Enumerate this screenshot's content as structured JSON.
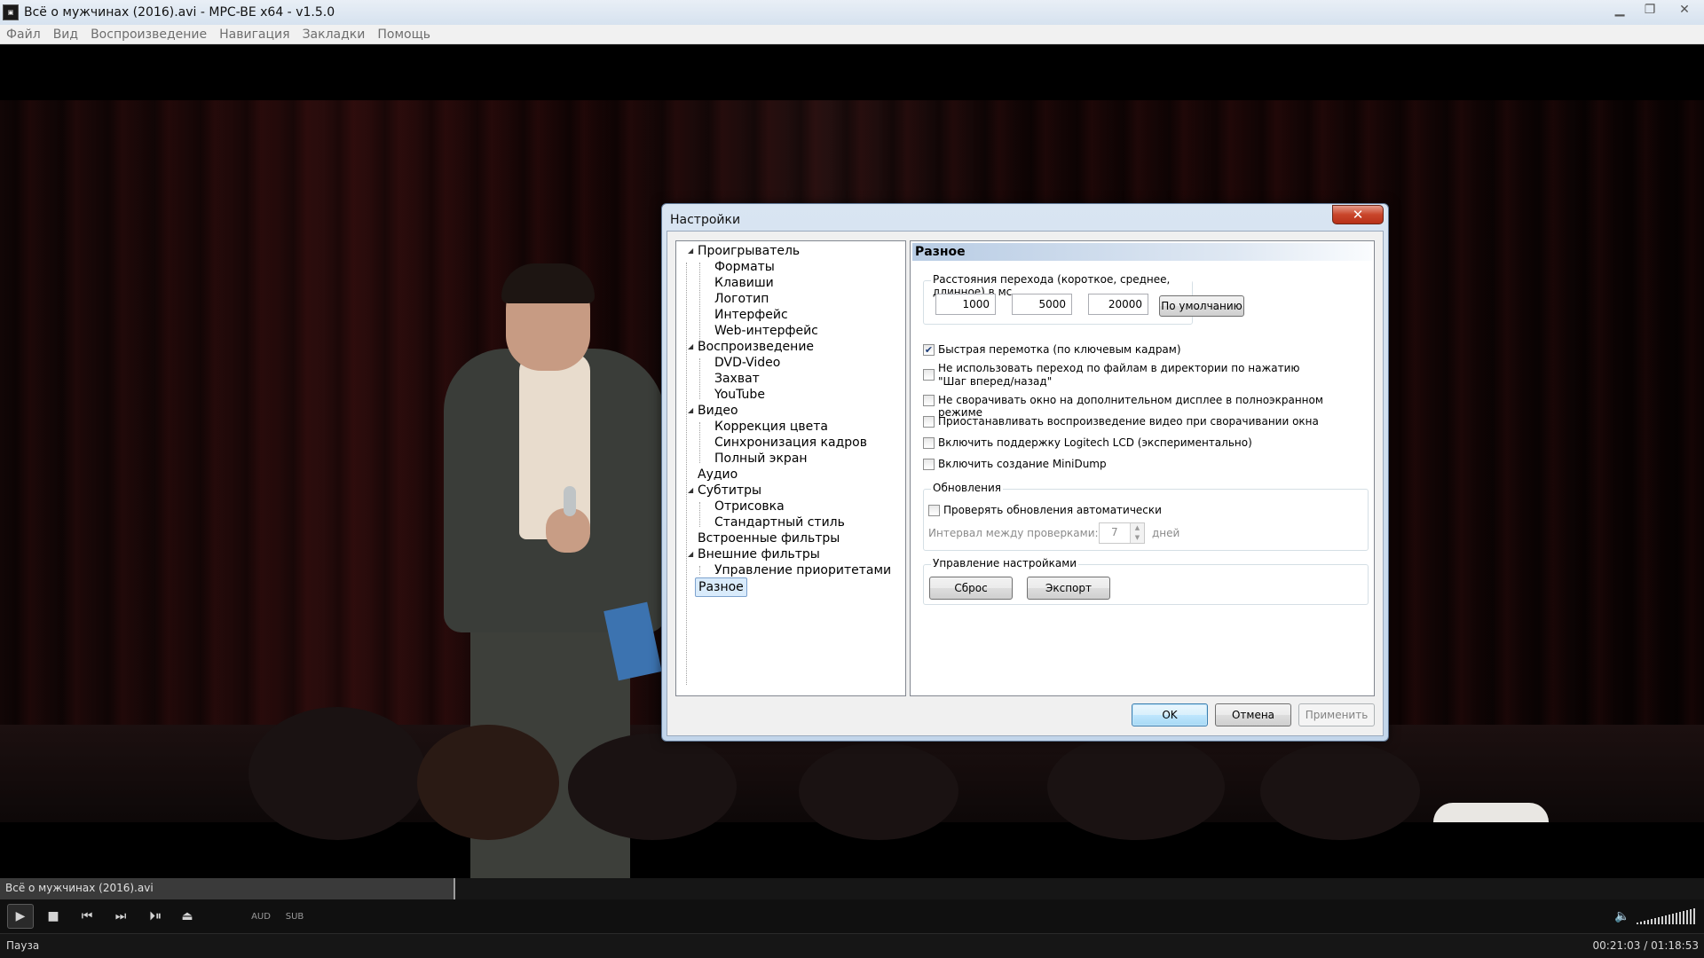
{
  "window": {
    "title": "Всё о мужчинах (2016).avi - MPC-BE x64 - v1.5.0",
    "icon": "mpc-be-app-icon"
  },
  "menu": [
    "Файл",
    "Вид",
    "Воспроизведение",
    "Навигация",
    "Закладки",
    "Помощь"
  ],
  "dialog": {
    "title": "Настройки",
    "tree": [
      {
        "label": "Проигрыватель",
        "level": 0,
        "expanded": true
      },
      {
        "label": "Форматы",
        "level": 1
      },
      {
        "label": "Клавиши",
        "level": 1
      },
      {
        "label": "Логотип",
        "level": 1
      },
      {
        "label": "Интерфейс",
        "level": 1
      },
      {
        "label": "Web-интерфейс",
        "level": 1
      },
      {
        "label": "Воспроизведение",
        "level": 0,
        "expanded": true
      },
      {
        "label": "DVD-Video",
        "level": 1
      },
      {
        "label": "Захват",
        "level": 1
      },
      {
        "label": "YouTube",
        "level": 1
      },
      {
        "label": "Видео",
        "level": 0,
        "expanded": true
      },
      {
        "label": "Коррекция цвета",
        "level": 1
      },
      {
        "label": "Синхронизация кадров",
        "level": 1
      },
      {
        "label": "Полный экран",
        "level": 1
      },
      {
        "label": "Аудио",
        "level": 0
      },
      {
        "label": "Субтитры",
        "level": 0,
        "expanded": true
      },
      {
        "label": "Отрисовка",
        "level": 1
      },
      {
        "label": "Стандартный стиль",
        "level": 1
      },
      {
        "label": "Встроенные фильтры",
        "level": 0
      },
      {
        "label": "Внешние фильтры",
        "level": 0,
        "expanded": true
      },
      {
        "label": "Управление приоритетами",
        "level": 1
      },
      {
        "label": "Разное",
        "level": 0,
        "selected": true
      }
    ],
    "page": {
      "header": "Разное",
      "jump_group": {
        "title": "Расстояния перехода (короткое, среднее, длинное) в мс",
        "short": "1000",
        "medium": "5000",
        "long": "20000",
        "default_button": "По умолчанию"
      },
      "checkboxes": [
        {
          "label": "Быстрая перемотка (по ключевым кадрам)",
          "checked": true
        },
        {
          "label": "Не использовать переход по файлам в директории по нажатию \"Шаг вперед/назад\"",
          "checked": false
        },
        {
          "label": "Не сворачивать окно на дополнительном дисплее в полноэкранном режиме",
          "checked": false
        },
        {
          "label": "Приостанавливать воспроизведение видео при сворачивании окна",
          "checked": false
        },
        {
          "label": "Включить поддержку Logitech LCD (экспериментально)",
          "checked": false
        },
        {
          "label": "Включить создание MiniDump",
          "checked": false
        }
      ],
      "updates": {
        "title": "Обновления",
        "auto_check_label": "Проверять обновления автоматически",
        "auto_check": false,
        "interval_label": "Интервал между проверками:",
        "interval_value": "7",
        "interval_unit": "дней"
      },
      "settings_mgmt": {
        "title": "Управление настройками",
        "reset": "Сброс",
        "export": "Экспорт"
      }
    },
    "buttons": {
      "ok": "OK",
      "cancel": "Отмена",
      "apply": "Применить"
    }
  },
  "player": {
    "file_name": "Всё о мужчинах (2016).avi",
    "seek_progress": 0.267,
    "aud_label": "AUD",
    "sub_label": "SUB",
    "status": "Пауза",
    "time": "00:21:03 / 01:18:53",
    "volume_level": 1.0
  }
}
